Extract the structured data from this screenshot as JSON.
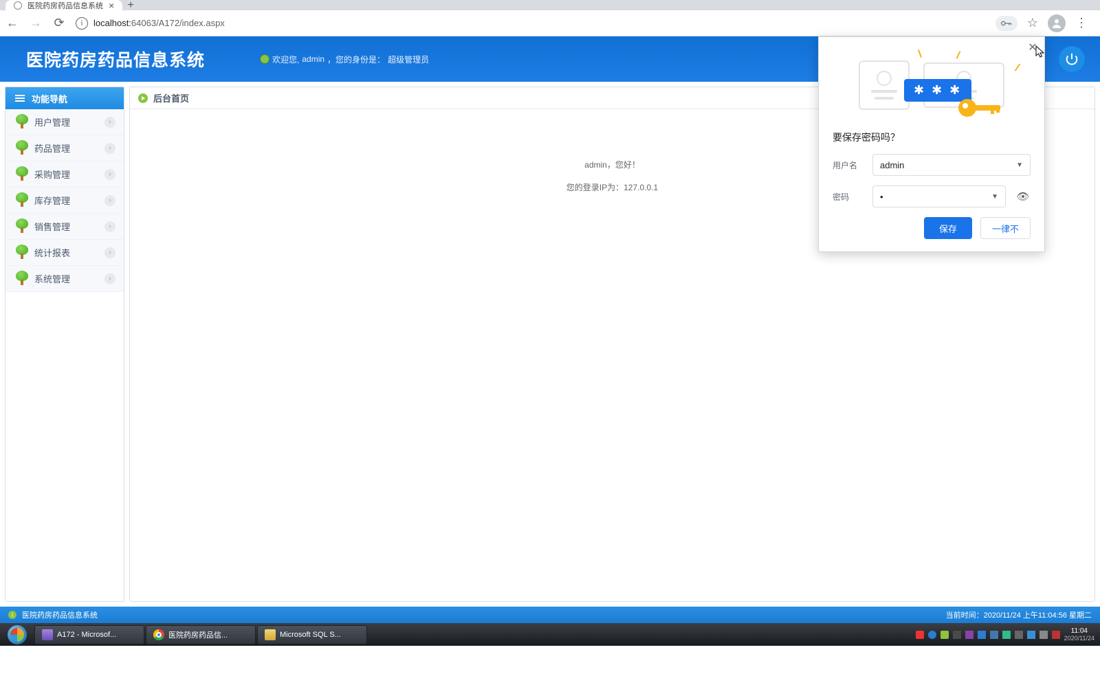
{
  "browser": {
    "tab_title": "医院药房药品信息系统",
    "url_host": "localhost:",
    "url_port_path": "64063/A172/index.aspx"
  },
  "app": {
    "title": "医院药房药品信息系统",
    "welcome_prefix": "欢迎您,",
    "welcome_user": "admin",
    "welcome_mid": "，您的身份是：",
    "welcome_role": "超级管理员"
  },
  "sidebar": {
    "header": "功能导航",
    "items": [
      {
        "label": "用户管理"
      },
      {
        "label": "药品管理"
      },
      {
        "label": "采购管理"
      },
      {
        "label": "库存管理"
      },
      {
        "label": "销售管理"
      },
      {
        "label": "统计报表"
      },
      {
        "label": "系统管理"
      }
    ]
  },
  "content": {
    "header": "后台首页",
    "greeting": "admin，您好！",
    "ip_line": "您的登录IP为：127.0.0.1"
  },
  "statusbar": {
    "left_text": "医院药房药品信息系统",
    "right_text": "当前时间：2020/11/24 上午11:04:56 星期二"
  },
  "save_password": {
    "title": "要保存密码吗？",
    "user_label": "用户名",
    "user_value": "admin",
    "pass_label": "密码",
    "pass_mask": "•",
    "save_btn": "保存",
    "never_btn": "一律不"
  },
  "taskbar": {
    "items": [
      {
        "label": "A172 - Microsof...",
        "color": "#6b4fbb"
      },
      {
        "label": "医院药房药品信...",
        "color": "#f3c84a"
      },
      {
        "label": "Microsoft SQL S...",
        "color": "#d6a63a"
      }
    ],
    "clock_time": "11:04",
    "clock_date": "2020/11/24"
  }
}
